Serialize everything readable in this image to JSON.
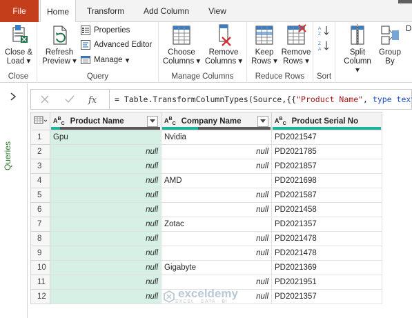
{
  "tabs": {
    "file": "File",
    "items": [
      "Home",
      "Transform",
      "Add Column",
      "View"
    ]
  },
  "ribbon": {
    "groups": {
      "close": "Close",
      "query": "Query",
      "manage_columns": "Manage Columns",
      "reduce_rows": "Reduce Rows",
      "sort": "Sort"
    },
    "close_load": [
      "Close &",
      "Load"
    ],
    "refresh_preview": [
      "Refresh",
      "Preview"
    ],
    "properties": "Properties",
    "advanced_editor": "Advanced Editor",
    "manage": "Manage",
    "choose_columns": [
      "Choose",
      "Columns"
    ],
    "remove_columns": [
      "Remove",
      "Columns"
    ],
    "keep_rows": [
      "Keep",
      "Rows"
    ],
    "remove_rows": [
      "Remove",
      "Rows"
    ],
    "split_column": [
      "Split",
      "Column"
    ],
    "group_by": [
      "Group",
      "By"
    ],
    "cut_letter": "D"
  },
  "queries_pane": {
    "label": "Queries"
  },
  "formula": {
    "prefix": "= Table.TransformColumnTypes(Source,{{",
    "str1": "\"Product Name\"",
    "mid": ", ",
    "kw1": "type text",
    "suffix": "},"
  },
  "table": {
    "columns": [
      "Product Name",
      "Company Name",
      "Product Serial No"
    ],
    "type_icon": "ABC",
    "null_text": "null",
    "rows": [
      {
        "n": "1",
        "product": "Gpu",
        "company": "Nvidia",
        "serial": "PD2021547"
      },
      {
        "n": "2",
        "product": null,
        "company": null,
        "serial": "PD2021785"
      },
      {
        "n": "3",
        "product": null,
        "company": null,
        "serial": "PD2021857"
      },
      {
        "n": "4",
        "product": null,
        "company": "AMD",
        "serial": "PD2021698"
      },
      {
        "n": "5",
        "product": null,
        "company": null,
        "serial": "PD2021587"
      },
      {
        "n": "6",
        "product": null,
        "company": null,
        "serial": "PD2021458"
      },
      {
        "n": "7",
        "product": null,
        "company": "Zotac",
        "serial": "PD2021357"
      },
      {
        "n": "8",
        "product": null,
        "company": null,
        "serial": "PD2021478"
      },
      {
        "n": "9",
        "product": null,
        "company": null,
        "serial": "PD2021478"
      },
      {
        "n": "10",
        "product": null,
        "company": "Gigabyte",
        "serial": "PD2021369"
      },
      {
        "n": "11",
        "product": null,
        "company": null,
        "serial": "PD2021951"
      },
      {
        "n": "12",
        "product": null,
        "company": null,
        "serial": "PD2021357"
      }
    ]
  },
  "watermark": {
    "name": "exceldemy",
    "tagline": "EXCEL · DATA · BI"
  },
  "colors": {
    "file_tab": "#c43e1c",
    "selected_column": "#d7f0e5",
    "quality_valid": "#1cb39b",
    "quality_empty": "#595959",
    "queries_label": "#2e7d32"
  }
}
